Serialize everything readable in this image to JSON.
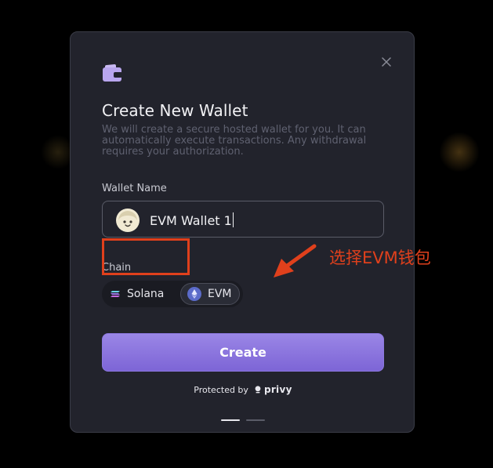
{
  "modal": {
    "title": "Create New Wallet",
    "description": "We will create a secure hosted wallet for you. It can automatically execute transactions. Any withdrawal requires your authorization.",
    "wallet_name_label": "Wallet Name",
    "wallet_name_value": "EVM Wallet 1",
    "chain_label": "Chain",
    "chain_options": [
      {
        "label": "Solana",
        "icon": "solana-icon",
        "selected": false
      },
      {
        "label": "EVM",
        "icon": "ethereum-icon",
        "selected": true
      }
    ],
    "create_button": "Create",
    "footer_text": "Protected by",
    "footer_brand": "privy",
    "pager": {
      "pages": 2,
      "active": 1
    }
  },
  "annotation": {
    "text": "选择EVM钱包",
    "color": "#e0401c"
  },
  "colors": {
    "modal_bg": "#22232c",
    "accent": "#8a73e0",
    "annotation": "#e0401c"
  }
}
